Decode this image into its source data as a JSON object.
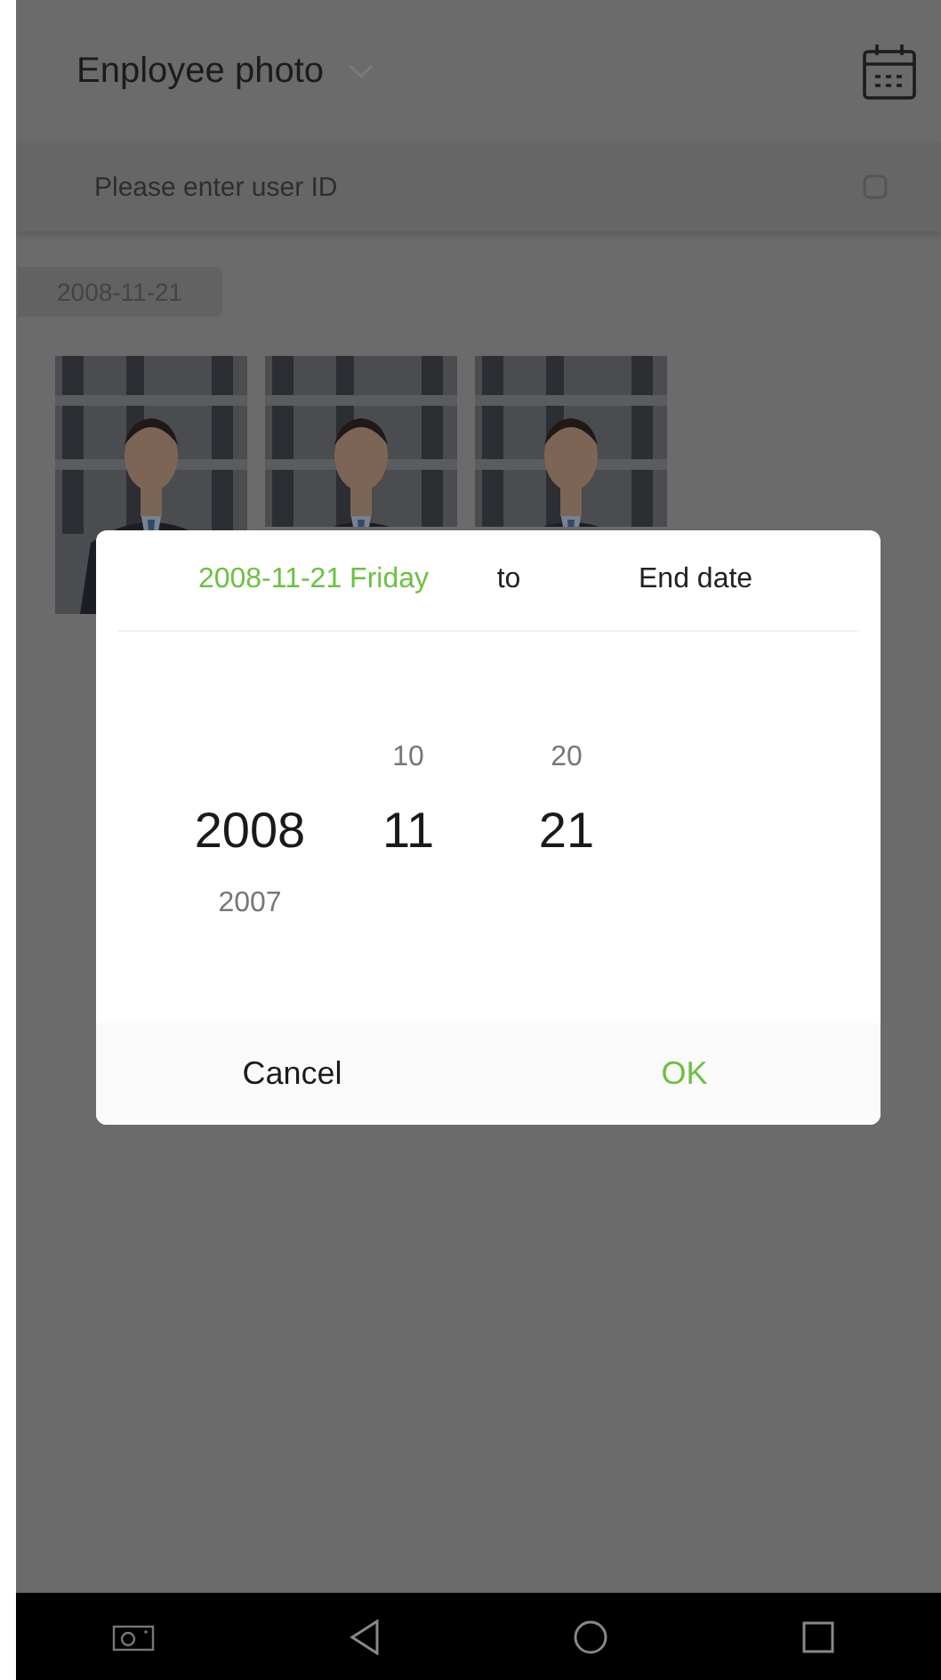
{
  "header": {
    "title": "Enployee photo"
  },
  "search": {
    "placeholder": "Please enter user ID"
  },
  "date_group": {
    "label": "2008-11-21"
  },
  "dialog": {
    "start_date": "2008-11-21 Friday",
    "separator": "to",
    "end_label": "End date",
    "columns": [
      {
        "items": [
          {
            "text": "2008",
            "selected": true
          },
          {
            "text": "2007",
            "selected": false
          }
        ]
      },
      {
        "items": [
          {
            "text": "10",
            "selected": false
          },
          {
            "text": "11",
            "selected": true
          }
        ]
      },
      {
        "items": [
          {
            "text": "20",
            "selected": false
          },
          {
            "text": "21",
            "selected": true
          }
        ]
      }
    ],
    "cancel": "Cancel",
    "ok": "OK"
  }
}
